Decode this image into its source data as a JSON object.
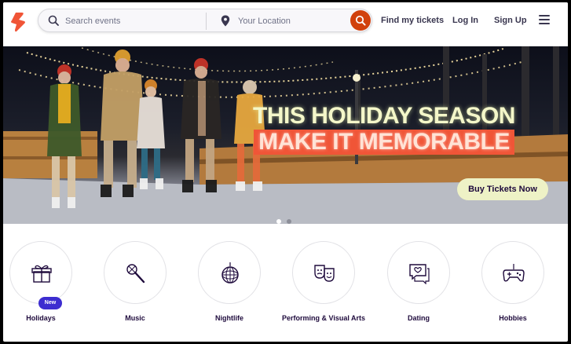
{
  "header": {
    "logo_icon": "eventbrite-logo-icon",
    "brand_color": "#f05537",
    "search": {
      "placeholder": "Search events",
      "location_placeholder": "Your Location",
      "search_button_icon": "search-icon",
      "search_button_color": "#d1410c"
    },
    "nav": {
      "find_tickets": "Find my tickets",
      "log_in": "Log In",
      "sign_up": "Sign Up",
      "menu_icon": "hamburger-menu-icon"
    }
  },
  "hero": {
    "headline_line1": "THIS HOLIDAY SEASON",
    "headline_line2": "MAKE IT MEMORABLE",
    "cta_label": "Buy Tickets Now",
    "carousel": {
      "total": 2,
      "active_index": 0
    },
    "colors": {
      "line1": "#f4f7c9",
      "line2_bg": "#f05537",
      "cta_bg": "#eef2c6"
    }
  },
  "categories": [
    {
      "label": "Holidays",
      "icon": "gift-icon",
      "badge": "New"
    },
    {
      "label": "Music",
      "icon": "microphone-icon"
    },
    {
      "label": "Nightlife",
      "icon": "disco-ball-icon"
    },
    {
      "label": "Performing & Visual Arts",
      "icon": "theater-masks-icon"
    },
    {
      "label": "Dating",
      "icon": "chat-heart-icon"
    },
    {
      "label": "Hobbies",
      "icon": "gamepad-icon"
    }
  ]
}
